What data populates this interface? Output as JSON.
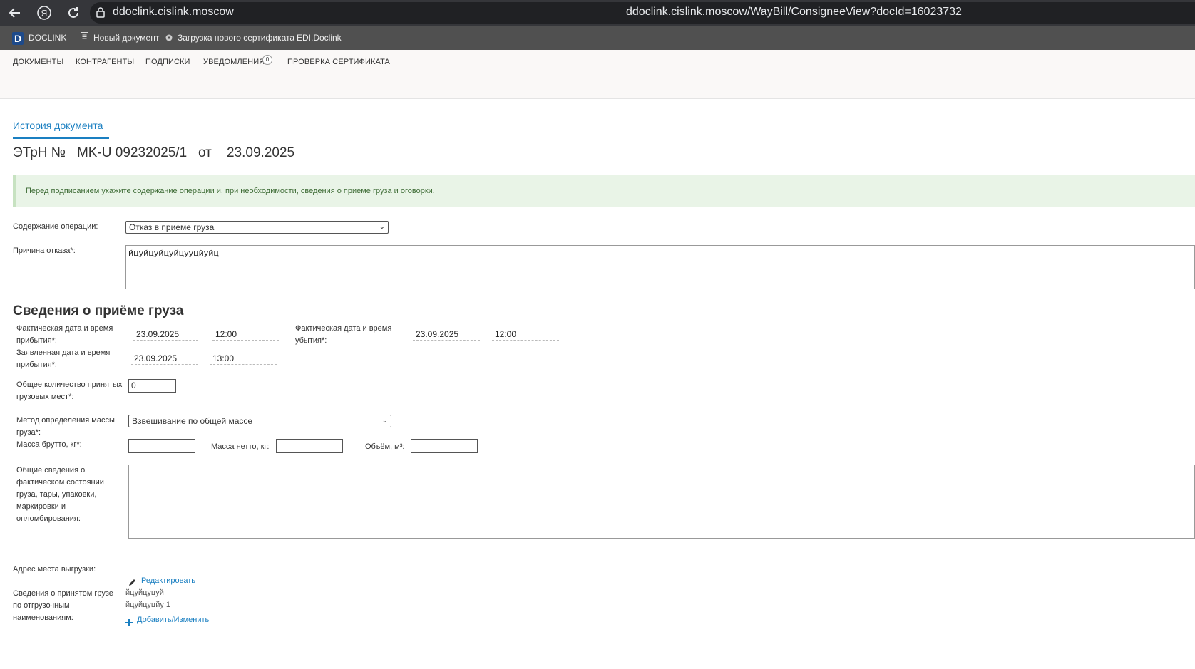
{
  "browser": {
    "host": "ddoclink.cislink.moscow",
    "url": "ddoclink.cislink.moscow/WayBill/ConsigneeView?docId=16023732",
    "back_icon": "back-arrow-icon",
    "yandex_icon": "yandex-icon",
    "reload_icon": "reload-icon",
    "yandex_glyph": "Я"
  },
  "bookmarks": {
    "logo_letter": "D",
    "items": [
      "DOCLINK",
      "Новый документ",
      "Загрузка нового сертификата",
      "EDI.Doclink"
    ]
  },
  "nav": {
    "items": [
      "ДОКУМЕНТЫ",
      "КОНТРАГЕНТЫ",
      "ПОДПИСКИ",
      "УВЕДОМЛЕНИЯ",
      "ПРОВЕРКА СЕРТИФИКАТА"
    ],
    "notifications_count": "0"
  },
  "page": {
    "history_link": "История документа",
    "doc_title": "ЭТрН №   MK-U 09232025/1   от    23.09.2025",
    "alert": "Перед подписанием укажите содержание операции и, при необходимости, сведения о приеме груза и оговорки.",
    "colors": {
      "accent": "#1a7fc1",
      "alert_bg": "#e9f4e7",
      "alert_text": "#3d6b35"
    }
  },
  "form": {
    "operation_label": "Содержание операции:",
    "operation_value": "Отказ в приеме груза",
    "reason_label": "Причина отказа*:",
    "reason_value": "йцуйцуйцуйцууцйуйц"
  },
  "cargo": {
    "section_title": "Сведения о приёме груза",
    "arrival_actual_label": "Фактическая дата и время прибытия*:",
    "arrival_actual_date": "23.09.2025",
    "arrival_actual_time": "12:00",
    "departure_actual_label": "Фактическая дата и время убытия*:",
    "departure_actual_date": "23.09.2025",
    "departure_actual_time": "12:00",
    "arrival_declared_label": "Заявленная дата и время прибытия*:",
    "arrival_declared_date": "23.09.2025",
    "arrival_declared_time": "13:00",
    "places_label": "Общее количество принятых грузовых мест*:",
    "places_value": "0",
    "mass_method_label": "Метод определения массы груза*:",
    "mass_method_value": "Взвешивание по общей массе",
    "gross_label": "Масса брутто, кг*:",
    "gross_value": "",
    "net_label": "Масса нетто, кг:",
    "net_value": "",
    "volume_label": "Объём, м³:",
    "volume_value": "",
    "condition_label": "Общие сведения о фактическом состоянии груза, тары, упаковки, маркировки и опломбирования:",
    "condition_value": "",
    "unload_address_label": "Адрес места выгрузки:",
    "edit_link": "Редактировать",
    "received_label": "Сведения о принятом грузе по отгрузочным наименованиям:",
    "received_items": [
      "йцуйцуцуй",
      "йцуйцуцйу 1"
    ],
    "add_change_link": "Добавить/Изменить"
  }
}
